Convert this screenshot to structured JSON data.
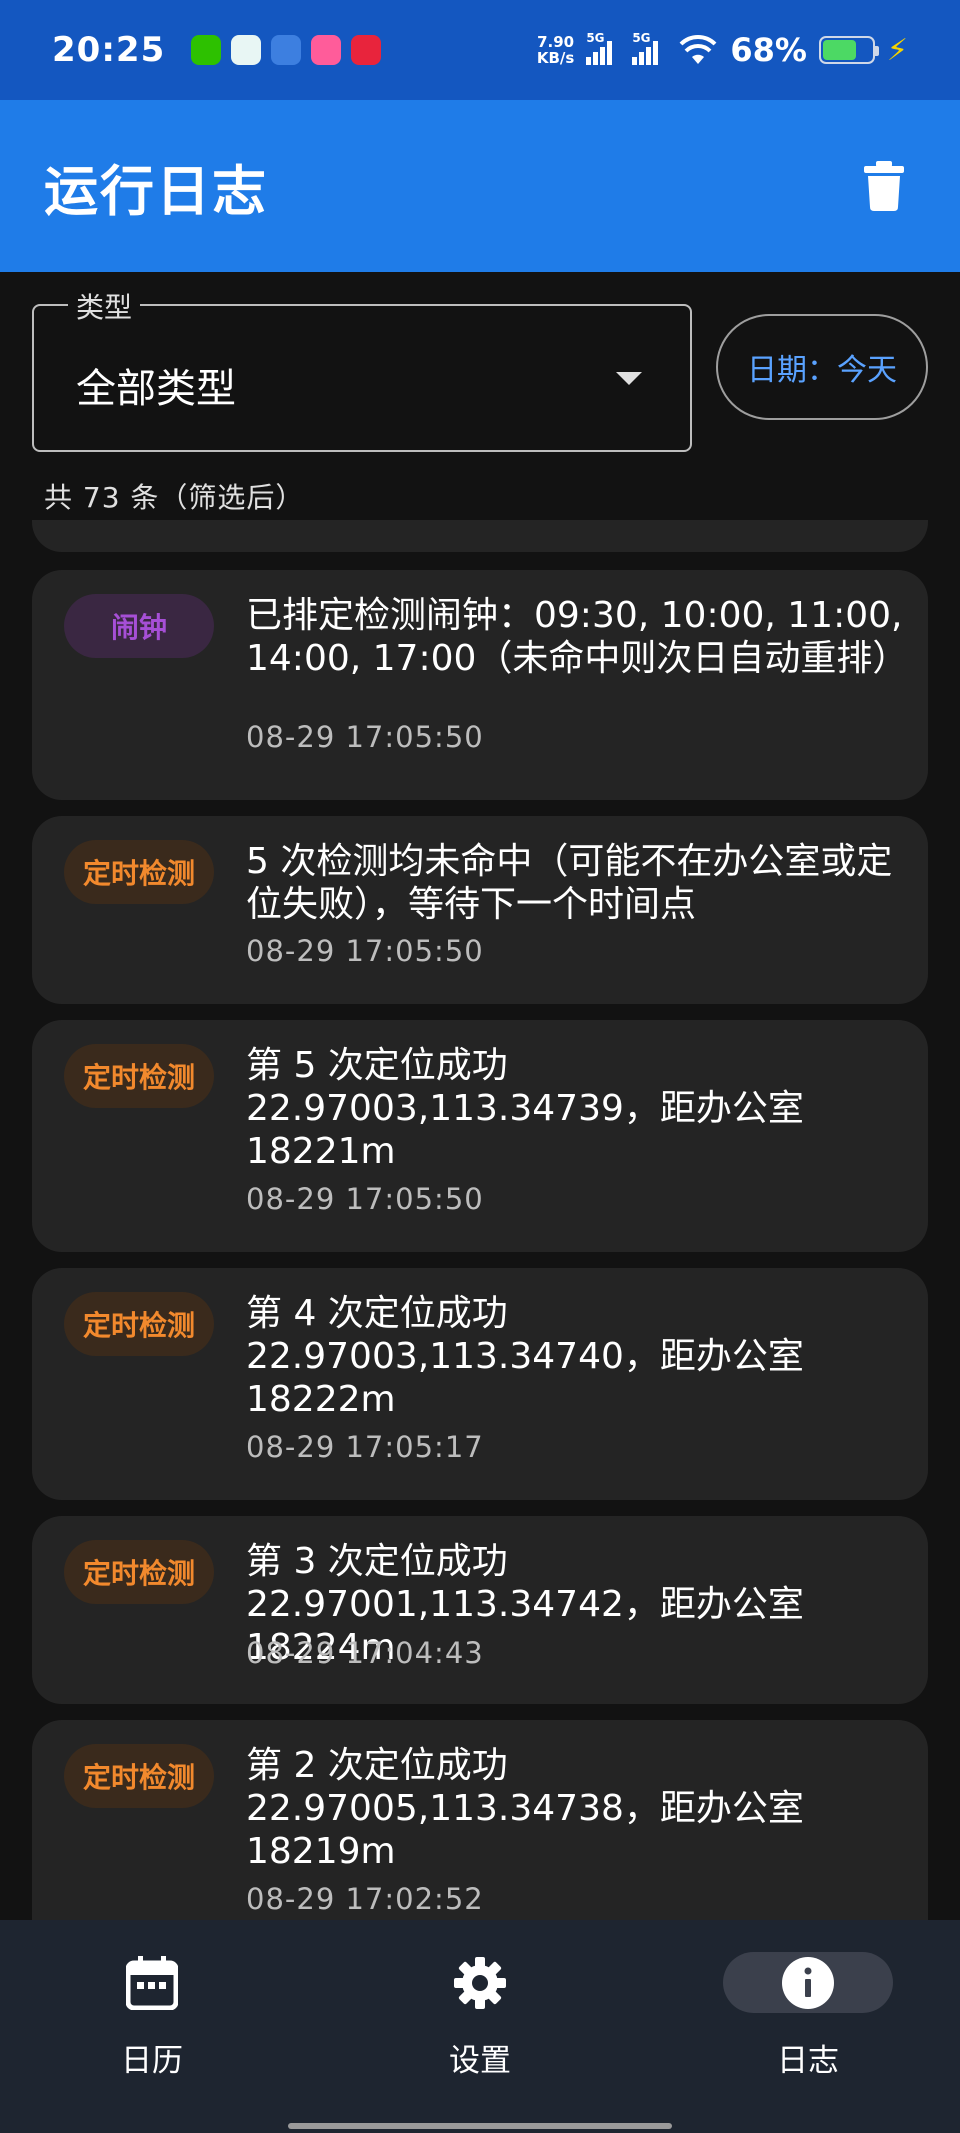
{
  "status_bar": {
    "time": "20:25",
    "net_speed_value": "7.90",
    "net_speed_unit": "KB/s",
    "signal_1_label": "5G",
    "signal_2_label": "5G",
    "battery_percent": "68%",
    "battery_level": 0.68,
    "notification_icons": [
      "wechat-icon",
      "notes-icon",
      "weather-icon",
      "app-icon-pink",
      "app-icon-red"
    ]
  },
  "app_bar": {
    "title": "运行日志",
    "trash_icon": "trash-icon",
    "background": "#1f7ce8"
  },
  "filters": {
    "type_label": "类型",
    "type_value": "全部类型",
    "date_chip": "日期：今天"
  },
  "count_text": "共 73 条（筛选后）",
  "logs": [
    {
      "tag": "闹钟",
      "tag_kind": "alarm",
      "message": "已排定检测闹钟：09:30, 10:00, 11:00, 14:00, 17:00（未命中则次日自动重排）",
      "time": "08-29 17:05:50"
    },
    {
      "tag": "定时检测",
      "tag_kind": "check",
      "message": "5 次检测均未命中（可能不在办公室或定位失败），等待下一个时间点",
      "time": "08-29 17:05:50"
    },
    {
      "tag": "定时检测",
      "tag_kind": "check",
      "message": "第 5 次定位成功 22.97003,113.34739，距办公室 18221m",
      "time": "08-29 17:05:50"
    },
    {
      "tag": "定时检测",
      "tag_kind": "check",
      "message": "第 4 次定位成功 22.97003,113.34740，距办公室 18222m",
      "time": "08-29 17:05:17"
    },
    {
      "tag": "定时检测",
      "tag_kind": "check",
      "message": "第 3 次定位成功 22.97001,113.34742，距办公室 18224m",
      "time": "08-29 17:04:43"
    },
    {
      "tag": "定时检测",
      "tag_kind": "check",
      "message": "第 2 次定位成功 22.97005,113.34738，距办公室 18219m",
      "time": "08-29 17:02:52"
    }
  ],
  "bottom_nav": {
    "calendar_label": "日历",
    "settings_label": "设置",
    "log_label": "日志",
    "active": "log"
  },
  "colors": {
    "alarm_tag": "#a64fd6",
    "check_tag": "#f2892d",
    "date_chip_text": "#5aa2ff"
  }
}
